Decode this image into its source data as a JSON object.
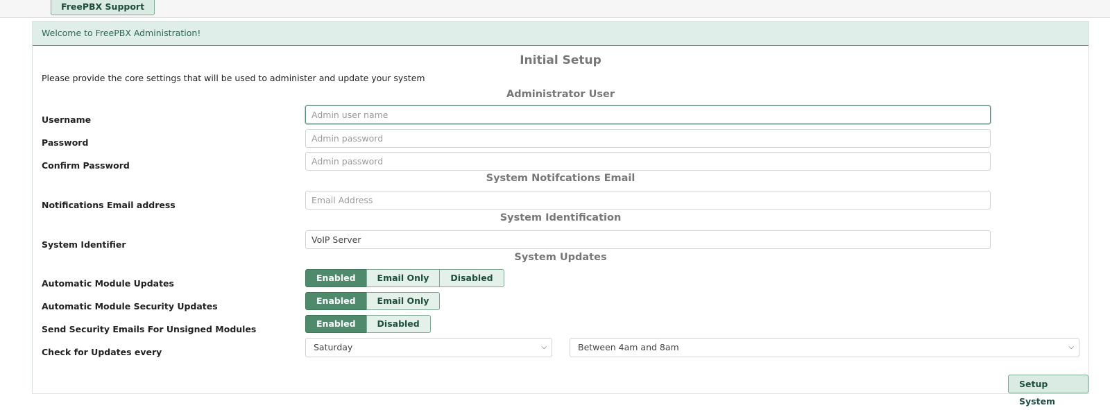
{
  "topbar": {
    "support_label": "FreePBX Support"
  },
  "panel": {
    "heading": "Welcome to FreePBX Administration!"
  },
  "page": {
    "title": "Initial Setup",
    "intro": "Please provide the core settings that will be used to administer and update your system"
  },
  "admin": {
    "section_title": "Administrator User",
    "username_label": "Username",
    "username_placeholder": "Admin user name",
    "password_label": "Password",
    "password_placeholder": "Admin password",
    "confirm_label": "Confirm Password",
    "confirm_placeholder": "Admin password"
  },
  "notifications": {
    "section_title": "System Notifcations Email",
    "email_label": "Notifications Email address",
    "email_placeholder": "Email Address"
  },
  "identification": {
    "section_title": "System Identification",
    "identifier_label": "System Identifier",
    "identifier_value": "VoIP Server"
  },
  "updates": {
    "section_title": "System Updates",
    "module_updates": {
      "label": "Automatic Module Updates",
      "options": [
        "Enabled",
        "Email Only",
        "Disabled"
      ],
      "selected": "Enabled"
    },
    "security_updates": {
      "label": "Automatic Module Security Updates",
      "options": [
        "Enabled",
        "Email Only"
      ],
      "selected": "Enabled"
    },
    "unsigned_emails": {
      "label": "Send Security Emails For Unsigned Modules",
      "options": [
        "Enabled",
        "Disabled"
      ],
      "selected": "Enabled"
    },
    "check_schedule": {
      "label": "Check for Updates every",
      "day_value": "Saturday",
      "time_value": "Between 4am and 8am"
    }
  },
  "actions": {
    "setup_label": "Setup System"
  },
  "colors": {
    "accent": "#4f8a6d",
    "heading_bg": "#dfeee8",
    "button_bg": "#d9ebe3"
  }
}
